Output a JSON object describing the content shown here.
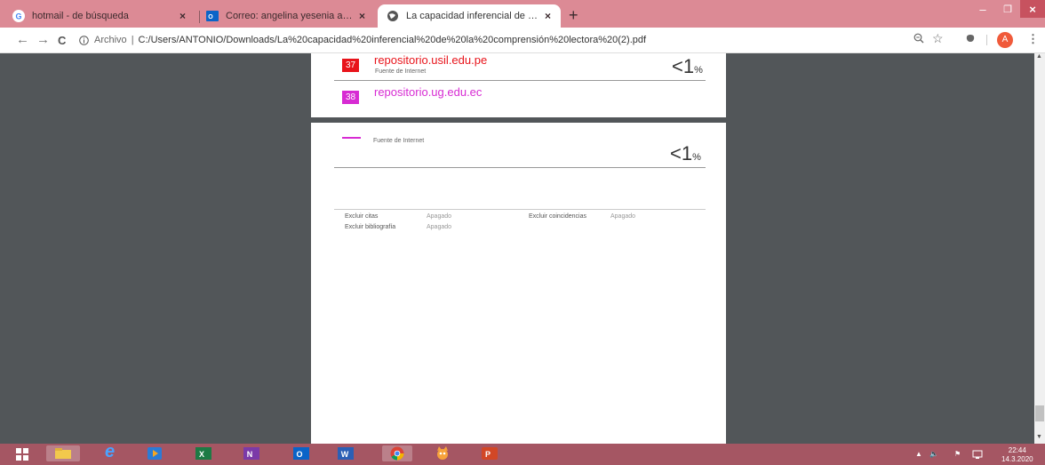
{
  "browser": {
    "tabs": [
      {
        "title": "hotmail - de búsqueda",
        "close": "×"
      },
      {
        "title": "Correo: angelina yesenia avila vil",
        "close": "×"
      },
      {
        "title": "La capacidad inferencial de la co",
        "close": "×"
      }
    ],
    "new_tab": "+",
    "window": {
      "minimize": "–",
      "maximize": "❐",
      "close": "×"
    },
    "nav": {
      "back": "←",
      "forward": "→",
      "reload": "C"
    },
    "omnibox": {
      "scheme_label": "Archivo",
      "separator": "|",
      "url": "C:/Users/ANTONIO/Downloads/La%20capacidad%20inferencial%20de%20la%20comprensión%20lectora%20(2).pdf"
    },
    "profile_initial": "A"
  },
  "pdf": {
    "entries": [
      {
        "number": "37",
        "source": "repositorio.usil.edu.pe",
        "type": "Fuente de Internet",
        "percent": "<1",
        "unit": "%",
        "color": "#e8141b"
      },
      {
        "number": "38",
        "source": "repositorio.ug.edu.ec",
        "color": "#d72bd3"
      }
    ],
    "continued_entry": {
      "type": "Fuente de Internet",
      "percent": "<1",
      "unit": "%",
      "color": "#d72bd3"
    },
    "options": {
      "exclude_quotes_label": "Excluir citas",
      "exclude_quotes_value": "Apagado",
      "exclude_matches_label": "Excluir coincidencias",
      "exclude_matches_value": "Apagado",
      "exclude_bibliography_label": "Excluir bibliografía",
      "exclude_bibliography_value": "Apagado"
    }
  },
  "taskbar": {
    "apps": [
      "start",
      "file-explorer",
      "internet-explorer",
      "media-player",
      "excel",
      "onenote",
      "outlook",
      "word",
      "chrome",
      "scratch",
      "powerpoint"
    ],
    "time": "22:44",
    "date": "14.3.2020"
  }
}
